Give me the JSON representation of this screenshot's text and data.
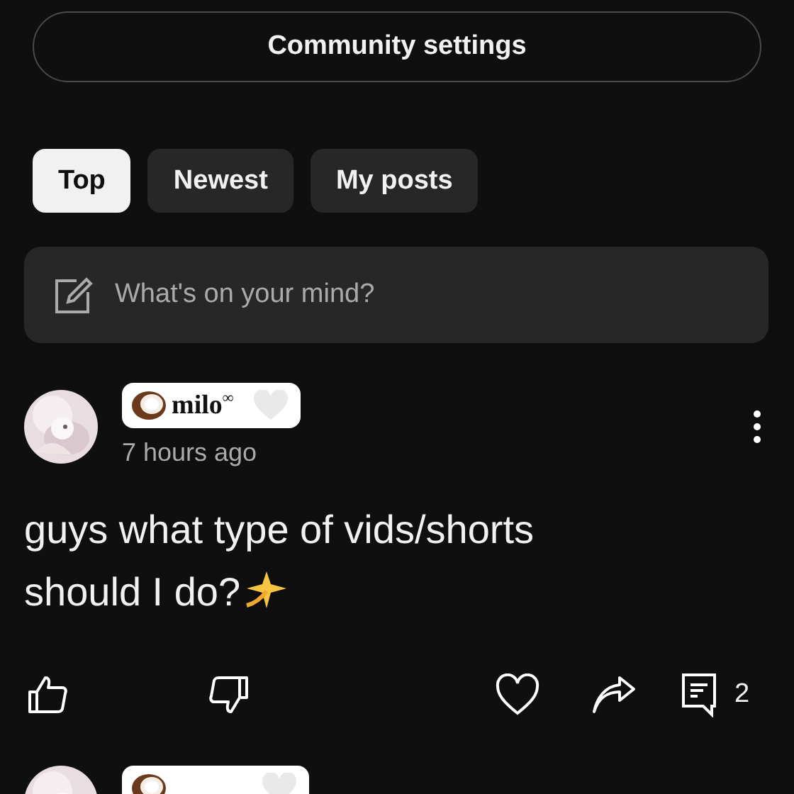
{
  "settings_button": "Community settings",
  "filters": [
    {
      "label": "Top",
      "selected": true
    },
    {
      "label": "Newest",
      "selected": false
    },
    {
      "label": "My posts",
      "selected": false
    }
  ],
  "compose": {
    "placeholder": "What's on your mind?"
  },
  "posts": [
    {
      "author": "milo$^{∞}$",
      "time": "7 hours ago",
      "text": "guys what type of vids/shorts should I do?",
      "comment_count": "2"
    }
  ]
}
